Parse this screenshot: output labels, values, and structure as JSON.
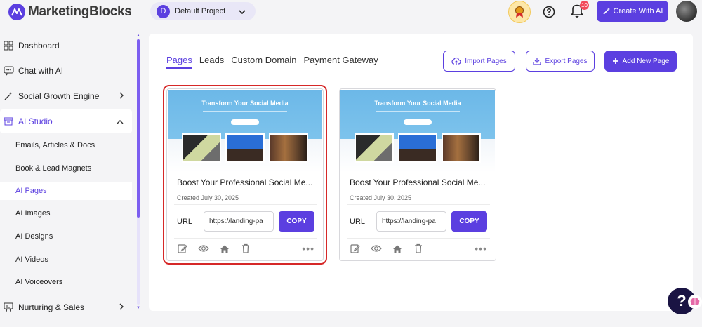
{
  "app": {
    "name": "MarketingBlocks"
  },
  "project": {
    "avatar_letter": "D",
    "name": "Default Project"
  },
  "header": {
    "notif_count": "10",
    "create_label": "Create With AI"
  },
  "sidebar": {
    "items": [
      {
        "label": "Dashboard"
      },
      {
        "label": "Chat with AI"
      },
      {
        "label": "Social Growth Engine"
      },
      {
        "label": "AI Studio"
      },
      {
        "label": "Nurturing & Sales"
      }
    ],
    "sub_items": [
      {
        "label": "Emails, Articles & Docs"
      },
      {
        "label": "Book & Lead Magnets"
      },
      {
        "label": "AI Pages"
      },
      {
        "label": "AI Images"
      },
      {
        "label": "AI Designs"
      },
      {
        "label": "AI Videos"
      },
      {
        "label": "AI Voiceovers"
      }
    ]
  },
  "tabs": [
    {
      "label": "Pages"
    },
    {
      "label": "Leads"
    },
    {
      "label": "Custom Domain"
    },
    {
      "label": "Payment Gateway"
    }
  ],
  "toolbar": {
    "import_label": "Import Pages",
    "export_label": "Export Pages",
    "add_label": "Add New Page"
  },
  "cards": [
    {
      "thumb_title": "Transform Your Social Media",
      "title": "Boost Your Professional Social Me...",
      "date": "Created July 30, 2025",
      "url_label": "URL",
      "url": "https://landing-pa",
      "copy_label": "COPY",
      "more": "•••"
    },
    {
      "thumb_title": "Transform Your Social Media",
      "title": "Boost Your Professional Social Me...",
      "date": "Created July 30, 2025",
      "url_label": "URL",
      "url": "https://landing-pa",
      "copy_label": "COPY",
      "more": "•••"
    }
  ],
  "help": {
    "label": "?"
  },
  "colors": {
    "accent": "#5b3fe0",
    "highlight": "#d62828"
  }
}
